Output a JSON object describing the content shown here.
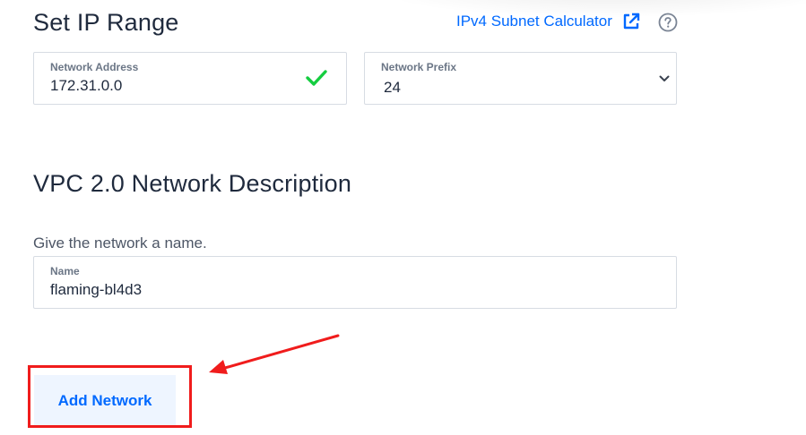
{
  "ip_range": {
    "title": "Set IP Range",
    "calculator_link": "IPv4 Subnet Calculator",
    "network_address": {
      "label": "Network Address",
      "value": "172.31.0.0"
    },
    "network_prefix": {
      "label": "Network Prefix",
      "selected": "24"
    }
  },
  "description": {
    "title": "VPC 2.0 Network Description",
    "helper": "Give the network a name.",
    "name_field": {
      "label": "Name",
      "value": "flaming-bl4d3"
    }
  },
  "actions": {
    "add_network_label": "Add Network"
  },
  "colors": {
    "accent": "#0069ff",
    "valid": "#15cd40",
    "annotation": "#f01c1c",
    "button_bg": "#eef5ff"
  },
  "icons": {
    "external_link": "external-link-icon",
    "help": "help-icon",
    "valid": "check-icon",
    "dropdown": "chevron-down-icon"
  }
}
